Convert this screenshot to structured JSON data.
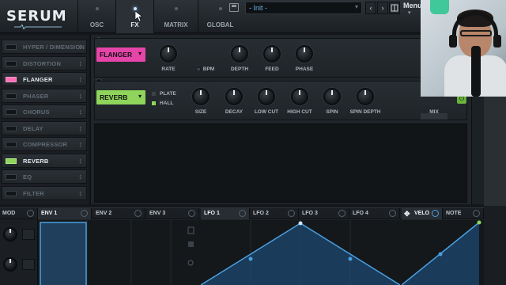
{
  "app": {
    "logo": "SERUM"
  },
  "tabs": [
    {
      "label": "OSC",
      "active": false
    },
    {
      "label": "FX",
      "active": true
    },
    {
      "label": "MATRIX",
      "active": false
    },
    {
      "label": "GLOBAL",
      "active": false
    }
  ],
  "preset": {
    "name": "- Init -",
    "prev": "‹",
    "next": "›",
    "menu": "Menu",
    "menu_caret": "▾"
  },
  "fx_list": [
    {
      "name": "HYPER / DIMENSION",
      "on": false,
      "color": ""
    },
    {
      "name": "DISTORTION",
      "on": false,
      "color": ""
    },
    {
      "name": "FLANGER",
      "on": true,
      "color": "#ff6eb4"
    },
    {
      "name": "PHASER",
      "on": false,
      "color": ""
    },
    {
      "name": "CHORUS",
      "on": false,
      "color": ""
    },
    {
      "name": "DELAY",
      "on": false,
      "color": ""
    },
    {
      "name": "COMPRESSOR",
      "on": false,
      "color": ""
    },
    {
      "name": "REVERB",
      "on": true,
      "color": "#8fd45b"
    },
    {
      "name": "EQ",
      "on": false,
      "color": ""
    },
    {
      "name": "FILTER",
      "on": false,
      "color": ""
    }
  ],
  "flanger": {
    "name": "FLANGER",
    "color": "#e544a8",
    "knobs": [
      "RATE",
      "DEPTH",
      "FEED",
      "PHASE"
    ],
    "bpm_label": "BPM"
  },
  "reverb": {
    "name": "REVERB",
    "color": "#8fd45b",
    "options": [
      "PLATE",
      "HALL"
    ],
    "selected_option": "HALL",
    "knobs": [
      "SIZE",
      "DECAY",
      "LOW CUT",
      "HIGH CUT",
      "SPIN",
      "SPIN DEPTH"
    ],
    "mix_label": "MIX"
  },
  "mod_tabs": [
    "MOD",
    "ENV 1",
    "ENV 2",
    "ENV 3",
    "LFO 1",
    "LFO 2",
    "LFO 3",
    "LFO 4",
    "VELO",
    "NOTE"
  ],
  "selected_mod_tabs": [
    "ENV 1",
    "LFO 1",
    "VELO"
  ],
  "colors": {
    "accent": "#4a9fe0",
    "bg": "#15181b",
    "flanger": "#e544a8",
    "reverb": "#8fd45b"
  }
}
